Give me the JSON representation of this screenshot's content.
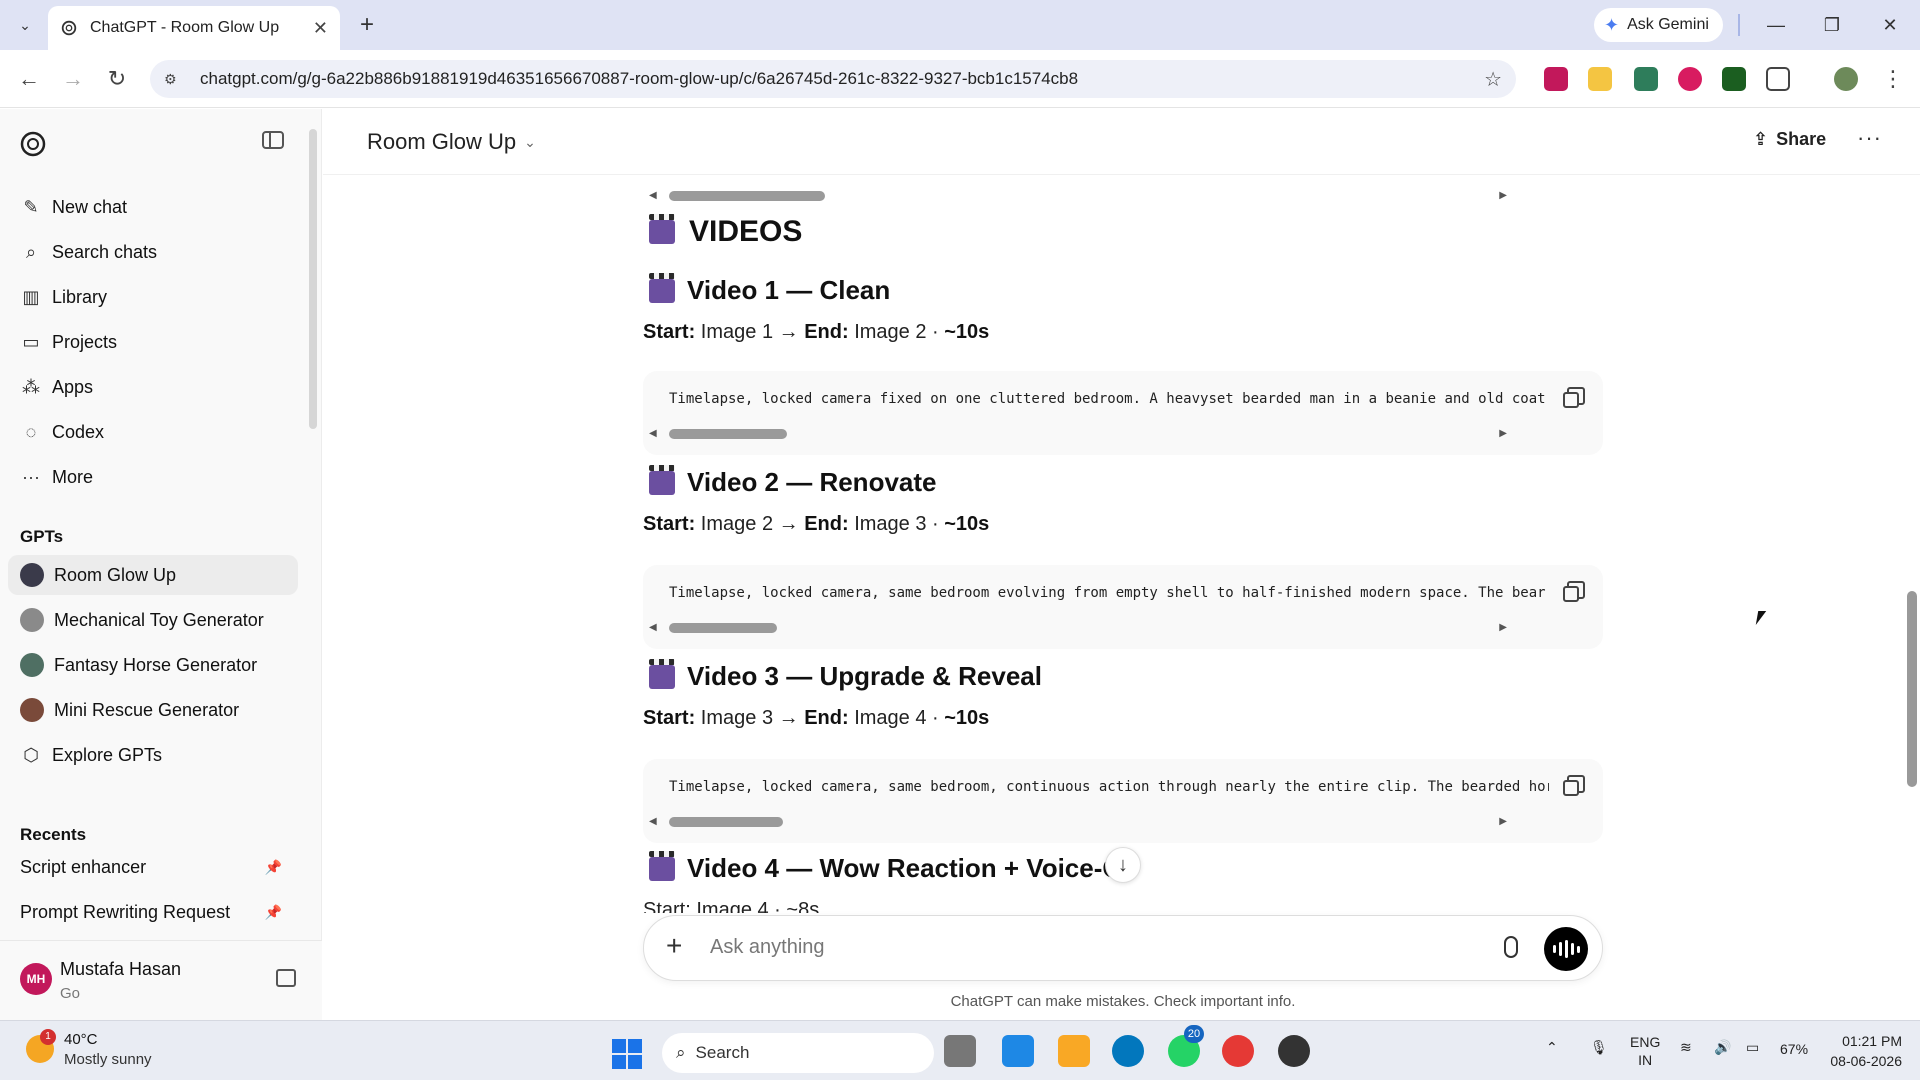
{
  "browser": {
    "tab_title": "ChatGPT - Room Glow Up",
    "new_tab_label": "+",
    "ask_gemini_label": "Ask Gemini",
    "url": "chatgpt.com/g/g-6a22b886b91881919d46351656670887-room-glow-up/c/6a26745d-261c-8322-9327-bcb1c1574cb8"
  },
  "sidebar": {
    "nav": [
      {
        "label": "New chat",
        "icon": "edit-icon"
      },
      {
        "label": "Search chats",
        "icon": "search-icon"
      },
      {
        "label": "Library",
        "icon": "library-icon"
      },
      {
        "label": "Projects",
        "icon": "folder-icon"
      },
      {
        "label": "Apps",
        "icon": "apps-icon"
      },
      {
        "label": "Codex",
        "icon": "codex-icon"
      },
      {
        "label": "More",
        "icon": "more-icon"
      }
    ],
    "gpts_heading": "GPTs",
    "gpts": [
      {
        "label": "Room Glow Up",
        "color": "#3a3a4a"
      },
      {
        "label": "Mechanical Toy Generator",
        "color": "#8a8a8a"
      },
      {
        "label": "Fantasy Horse Generator",
        "color": "#4f6f63"
      },
      {
        "label": "Mini Rescue Generator",
        "color": "#7a4a3a"
      },
      {
        "label": "Explore GPTs",
        "color": ""
      }
    ],
    "recents_heading": "Recents",
    "recents": [
      {
        "label": "Script enhancer"
      },
      {
        "label": "Prompt Rewriting Request"
      }
    ],
    "user": {
      "initials": "MH",
      "name": "Mustafa Hasan",
      "plan": "Go"
    }
  },
  "header": {
    "title": "Room Glow Up",
    "share_label": "Share",
    "more_label": "···"
  },
  "content": {
    "section_title": "VIDEOS",
    "videos": [
      {
        "title": "Video 1 — Clean",
        "start_label": "Start:",
        "start_value": "Image 1 →",
        "end_label": "End:",
        "end_value": "Image 2 ·",
        "duration": "~10s",
        "code": "Timelapse, locked camera fixed on one cluttered bedroom. A heavyset bearded man in a beanie and old coat"
      },
      {
        "title": "Video 2 — Renovate",
        "start_label": "Start:",
        "start_value": "Image 2 →",
        "end_label": "End:",
        "end_value": "Image 3 ·",
        "duration": "~10s",
        "code": "Timelapse, locked camera, same bedroom evolving from empty shell to half-finished modern space. The bear"
      },
      {
        "title": "Video 3 — Upgrade & Reveal",
        "start_label": "Start:",
        "start_value": "Image 3 →",
        "end_label": "End:",
        "end_value": "Image 4 ·",
        "duration": "~10s",
        "code": "Timelapse, locked camera, same bedroom, continuous action through nearly the entire clip. The bearded hor"
      },
      {
        "title": "Video 4 — Wow Reaction + Voice-Ov",
        "meta_partial": "Start: Image 4 · ~8s"
      }
    ]
  },
  "composer": {
    "placeholder": "Ask anything",
    "disclaimer": "ChatGPT can make mistakes. Check important info."
  },
  "taskbar": {
    "weather_temp": "40°C",
    "weather_cond": "Mostly sunny",
    "weather_badge": "1",
    "search_label": "Search",
    "whatsapp_badge": "20",
    "lang_top": "ENG",
    "lang_bottom": "IN",
    "battery": "67%",
    "time": "01:21 PM",
    "date": "08-06-2026"
  }
}
